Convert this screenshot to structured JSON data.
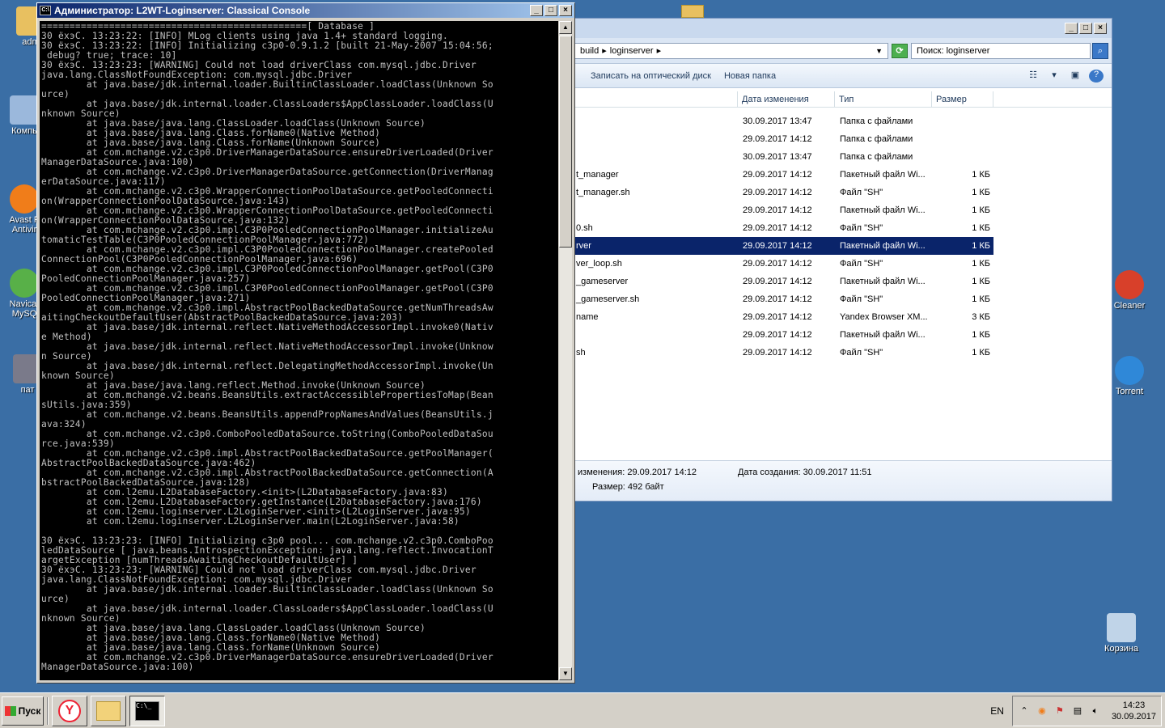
{
  "desktop": {
    "icons": [
      {
        "label": "adm",
        "color": "#e8c060"
      },
      {
        "label": "Компь",
        "color": "#9bb8dc"
      },
      {
        "label": "Avast F Antivir",
        "color": "#f07d1a"
      },
      {
        "label": "Navicat MySQ",
        "color": "#58b048"
      },
      {
        "label": "пат",
        "color": "#7a7a8a"
      },
      {
        "label": "Cleaner",
        "color": "#d8402a"
      },
      {
        "label": "Torrent",
        "color": "#2f88d8"
      },
      {
        "label": "Корзина",
        "color": "#c0d4e8"
      }
    ]
  },
  "console": {
    "title": "Администратор:  L2WT-Loginserver: Classical Console",
    "icon": "cmd-icon",
    "text": "===============================================[ Database ]\n30 ёхэС. 13:23:22: [INFO] MLog clients using java 1.4+ standard logging.\n30 ёхэС. 13:23:22: [INFO] Initializing c3p0-0.9.1.2 [built 21-May-2007 15:04:56;\n debug? true; trace: 10]\n30 ёхэС. 13:23:23: [WARNING] Could not load driverClass com.mysql.jdbc.Driver\njava.lang.ClassNotFoundException: com.mysql.jdbc.Driver\n        at java.base/jdk.internal.loader.BuiltinClassLoader.loadClass(Unknown So\nurce)\n        at java.base/jdk.internal.loader.ClassLoaders$AppClassLoader.loadClass(U\nnknown Source)\n        at java.base/java.lang.ClassLoader.loadClass(Unknown Source)\n        at java.base/java.lang.Class.forName0(Native Method)\n        at java.base/java.lang.Class.forName(Unknown Source)\n        at com.mchange.v2.c3p0.DriverManagerDataSource.ensureDriverLoaded(Driver\nManagerDataSource.java:100)\n        at com.mchange.v2.c3p0.DriverManagerDataSource.getConnection(DriverManag\nerDataSource.java:117)\n        at com.mchange.v2.c3p0.WrapperConnectionPoolDataSource.getPooledConnecti\non(WrapperConnectionPoolDataSource.java:143)\n        at com.mchange.v2.c3p0.WrapperConnectionPoolDataSource.getPooledConnecti\non(WrapperConnectionPoolDataSource.java:132)\n        at com.mchange.v2.c3p0.impl.C3P0PooledConnectionPoolManager.initializeAu\ntomaticTestTable(C3P0PooledConnectionPoolManager.java:772)\n        at com.mchange.v2.c3p0.impl.C3P0PooledConnectionPoolManager.createPooled\nConnectionPool(C3P0PooledConnectionPoolManager.java:696)\n        at com.mchange.v2.c3p0.impl.C3P0PooledConnectionPoolManager.getPool(C3P0\nPooledConnectionPoolManager.java:257)\n        at com.mchange.v2.c3p0.impl.C3P0PooledConnectionPoolManager.getPool(C3P0\nPooledConnectionPoolManager.java:271)\n        at com.mchange.v2.c3p0.impl.AbstractPoolBackedDataSource.getNumThreadsAw\naitingCheckoutDefaultUser(AbstractPoolBackedDataSource.java:203)\n        at java.base/jdk.internal.reflect.NativeMethodAccessorImpl.invoke0(Nativ\ne Method)\n        at java.base/jdk.internal.reflect.NativeMethodAccessorImpl.invoke(Unknow\nn Source)\n        at java.base/jdk.internal.reflect.DelegatingMethodAccessorImpl.invoke(Un\nknown Source)\n        at java.base/java.lang.reflect.Method.invoke(Unknown Source)\n        at com.mchange.v2.beans.BeansUtils.extractAccessiblePropertiesToMap(Bean\nsUtils.java:359)\n        at com.mchange.v2.beans.BeansUtils.appendPropNamesAndValues(BeansUtils.j\nava:324)\n        at com.mchange.v2.c3p0.ComboPooledDataSource.toString(ComboPooledDataSou\nrce.java:539)\n        at com.mchange.v2.c3p0.impl.AbstractPoolBackedDataSource.getPoolManager(\nAbstractPoolBackedDataSource.java:462)\n        at com.mchange.v2.c3p0.impl.AbstractPoolBackedDataSource.getConnection(A\nbstractPoolBackedDataSource.java:128)\n        at com.l2emu.L2DatabaseFactory.<init>(L2DatabaseFactory.java:83)\n        at com.l2emu.L2DatabaseFactory.getInstance(L2DatabaseFactory.java:176)\n        at com.l2emu.loginserver.L2LoginServer.<init>(L2LoginServer.java:95)\n        at com.l2emu.loginserver.L2LoginServer.main(L2LoginServer.java:58)\n\n30 ёхэС. 13:23:23: [INFO] Initializing c3p0 pool... com.mchange.v2.c3p0.ComboPoo\nledDataSource [ java.beans.IntrospectionException: java.lang.reflect.InvocationT\nargetException [numThreadsAwaitingCheckoutDefaultUser] ]\n30 ёхэС. 13:23:23: [WARNING] Could not load driverClass com.mysql.jdbc.Driver\njava.lang.ClassNotFoundException: com.mysql.jdbc.Driver\n        at java.base/jdk.internal.loader.BuiltinClassLoader.loadClass(Unknown So\nurce)\n        at java.base/jdk.internal.loader.ClassLoaders$AppClassLoader.loadClass(U\nnknown Source)\n        at java.base/java.lang.ClassLoader.loadClass(Unknown Source)\n        at java.base/java.lang.Class.forName0(Native Method)\n        at java.base/java.lang.Class.forName(Unknown Source)\n        at com.mchange.v2.c3p0.DriverManagerDataSource.ensureDriverLoaded(Driver\nManagerDataSource.java:100)"
  },
  "explorer": {
    "breadcrumb": [
      "build",
      "loginserver"
    ],
    "search_placeholder": "Поиск: loginserver",
    "toolbar": {
      "burn": "Записать на оптический диск",
      "new_folder": "Новая папка"
    },
    "columns": {
      "name": "",
      "date": "Дата изменения",
      "type": "Тип",
      "size": "Размер"
    },
    "rows": [
      {
        "name": "",
        "date": "30.09.2017 13:47",
        "type": "Папка с файлами",
        "size": ""
      },
      {
        "name": "",
        "date": "29.09.2017 14:12",
        "type": "Папка с файлами",
        "size": ""
      },
      {
        "name": "",
        "date": "30.09.2017 13:47",
        "type": "Папка с файлами",
        "size": ""
      },
      {
        "name": "t_manager",
        "date": "29.09.2017 14:12",
        "type": "Пакетный файл Wi...",
        "size": "1 КБ"
      },
      {
        "name": "t_manager.sh",
        "date": "29.09.2017 14:12",
        "type": "Файл \"SH\"",
        "size": "1 КБ"
      },
      {
        "name": "",
        "date": "29.09.2017 14:12",
        "type": "Пакетный файл Wi...",
        "size": "1 КБ"
      },
      {
        "name": "0.sh",
        "date": "29.09.2017 14:12",
        "type": "Файл \"SH\"",
        "size": "1 КБ"
      },
      {
        "name": "rver",
        "date": "29.09.2017 14:12",
        "type": "Пакетный файл Wi...",
        "size": "1 КБ",
        "selected": true
      },
      {
        "name": "ver_loop.sh",
        "date": "29.09.2017 14:12",
        "type": "Файл \"SH\"",
        "size": "1 КБ"
      },
      {
        "name": "_gameserver",
        "date": "29.09.2017 14:12",
        "type": "Пакетный файл Wi...",
        "size": "1 КБ"
      },
      {
        "name": "_gameserver.sh",
        "date": "29.09.2017 14:12",
        "type": "Файл \"SH\"",
        "size": "1 КБ"
      },
      {
        "name": "name",
        "date": "29.09.2017 14:12",
        "type": "Yandex Browser XM...",
        "size": "3 КБ"
      },
      {
        "name": "",
        "date": "29.09.2017 14:12",
        "type": "Пакетный файл Wi...",
        "size": "1 КБ"
      },
      {
        "name": "sh",
        "date": "29.09.2017 14:12",
        "type": "Файл \"SH\"",
        "size": "1 КБ"
      }
    ],
    "details": {
      "modified": "изменения: 29.09.2017 14:12",
      "created": "Дата создания: 30.09.2017 11:51",
      "size": "Размер: 492 байт"
    }
  },
  "taskbar": {
    "start_label": "Пуск",
    "lang": "EN",
    "time": "14:23",
    "date": "30.09.2017",
    "yandex_glyph": "Y",
    "cmd_glyph": "C:\\_"
  }
}
